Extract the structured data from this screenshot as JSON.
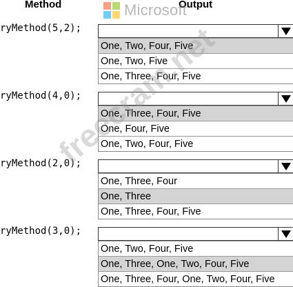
{
  "headers": {
    "method": "Method",
    "output": "Output"
  },
  "logo": {
    "text": "Microsoft",
    "colors": [
      "#f25022",
      "#7fba00",
      "#00a4ef",
      "#ffb900"
    ]
  },
  "watermark": "freecram.net",
  "rows": [
    {
      "call": "ryMethod(5,2);",
      "options": [
        "One, Two, Four, Five",
        "One, Two, Five",
        "One, Three, Four, Five"
      ],
      "selected_index": 0
    },
    {
      "call": "ryMethod(4,0);",
      "options": [
        "One, Three, Four, Five",
        "One, Four, Five",
        "One, Two, Four, Five"
      ],
      "selected_index": 0
    },
    {
      "call": "ryMethod(2,0);",
      "options": [
        "One, Three, Four",
        "One, Three",
        "One, Three, Four, Five"
      ],
      "selected_index": 1
    },
    {
      "call": "ryMethod(3,0);",
      "options": [
        "One, Two, Four, Five",
        "One, Three, One, Two, Four, Five",
        "One, Three, Four, One, Two, Four, Five"
      ],
      "selected_index": 1
    }
  ]
}
